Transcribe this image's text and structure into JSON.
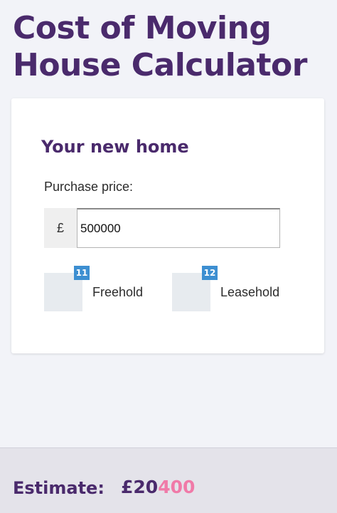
{
  "title": "Cost of Moving House Calculator",
  "form": {
    "section_title": "Your new home",
    "price_label": "Purchase price:",
    "currency_symbol": "£",
    "price_value": "500000",
    "options": [
      {
        "label": "Freehold",
        "badge": "11",
        "checked": false
      },
      {
        "label": "Leasehold",
        "badge": "12",
        "checked": false
      }
    ]
  },
  "estimate": {
    "label": "Estimate:",
    "currency": "£",
    "amount_prefix": "20",
    "amount_highlight": "400"
  },
  "colors": {
    "brand": "#4a2a6c",
    "badge": "#3d8fd1",
    "highlight": "#f07aa8",
    "background": "#f2f3f8"
  }
}
